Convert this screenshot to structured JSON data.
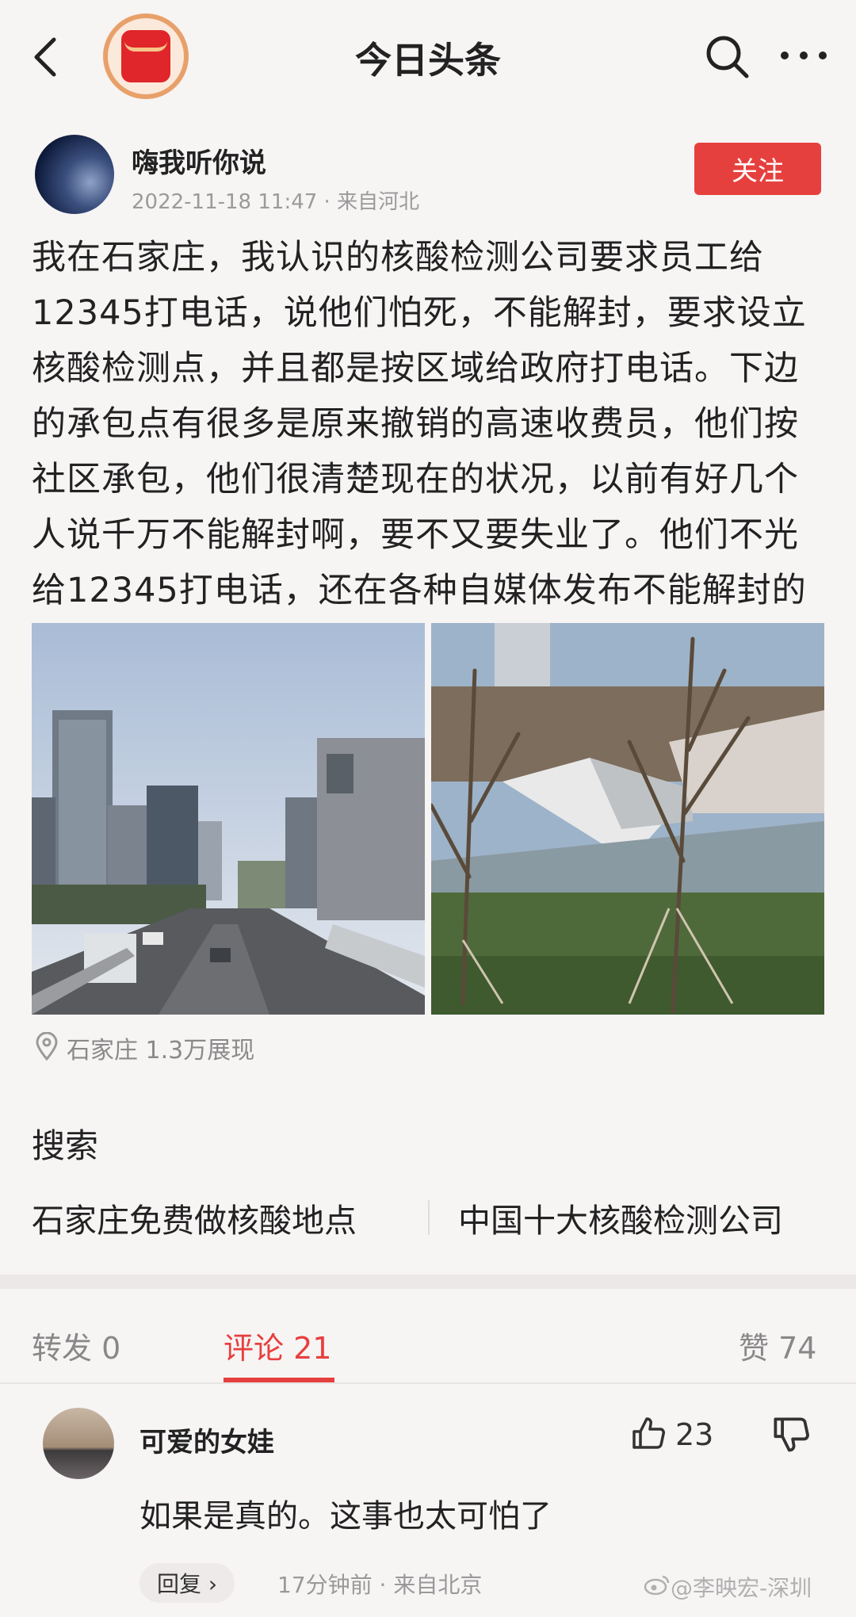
{
  "header": {
    "title": "今日头条",
    "back_icon": "chevron-left-icon",
    "search_icon": "search-icon",
    "more_icon": "more-horizontal-icon",
    "logo_icon": "red-envelope-icon"
  },
  "post": {
    "author": "嗨我听你说",
    "meta": "2022-11-18 11:47 · 来自河北",
    "follow_label": "关注",
    "body": "我在石家庄，我认识的核酸检测公司要求员工给12345打电话，说他们怕死，不能解封，要求设立核酸检测点，并且都是按区域给政府打电话。下边的承包点有很多是原来撤销的高速收费员，他们按社区承包，他们很清楚现在的状况，以前有好几个人说千万不能解封啊，要不又要失业了。他们不光给12345打电话，还在各种自媒体发布不能解封的信息。",
    "location_text": "石家庄  1.3万展现"
  },
  "search": {
    "title": "搜索",
    "items": [
      "石家庄免费做核酸地点",
      "中国十大核酸检测公司"
    ]
  },
  "tabs": {
    "forward": "转发 0",
    "comments": "评论 21",
    "likes": "赞 74"
  },
  "comment": {
    "author": "可爱的女娃",
    "like_count": "23",
    "text": "如果是真的。这事也太可怕了",
    "reply_label": "回复 ›",
    "meta": "17分钟前 · 来自北京"
  },
  "watermark": "@李映宏-深圳",
  "colors": {
    "accent": "#e6403e",
    "background": "#f7f4f4"
  }
}
